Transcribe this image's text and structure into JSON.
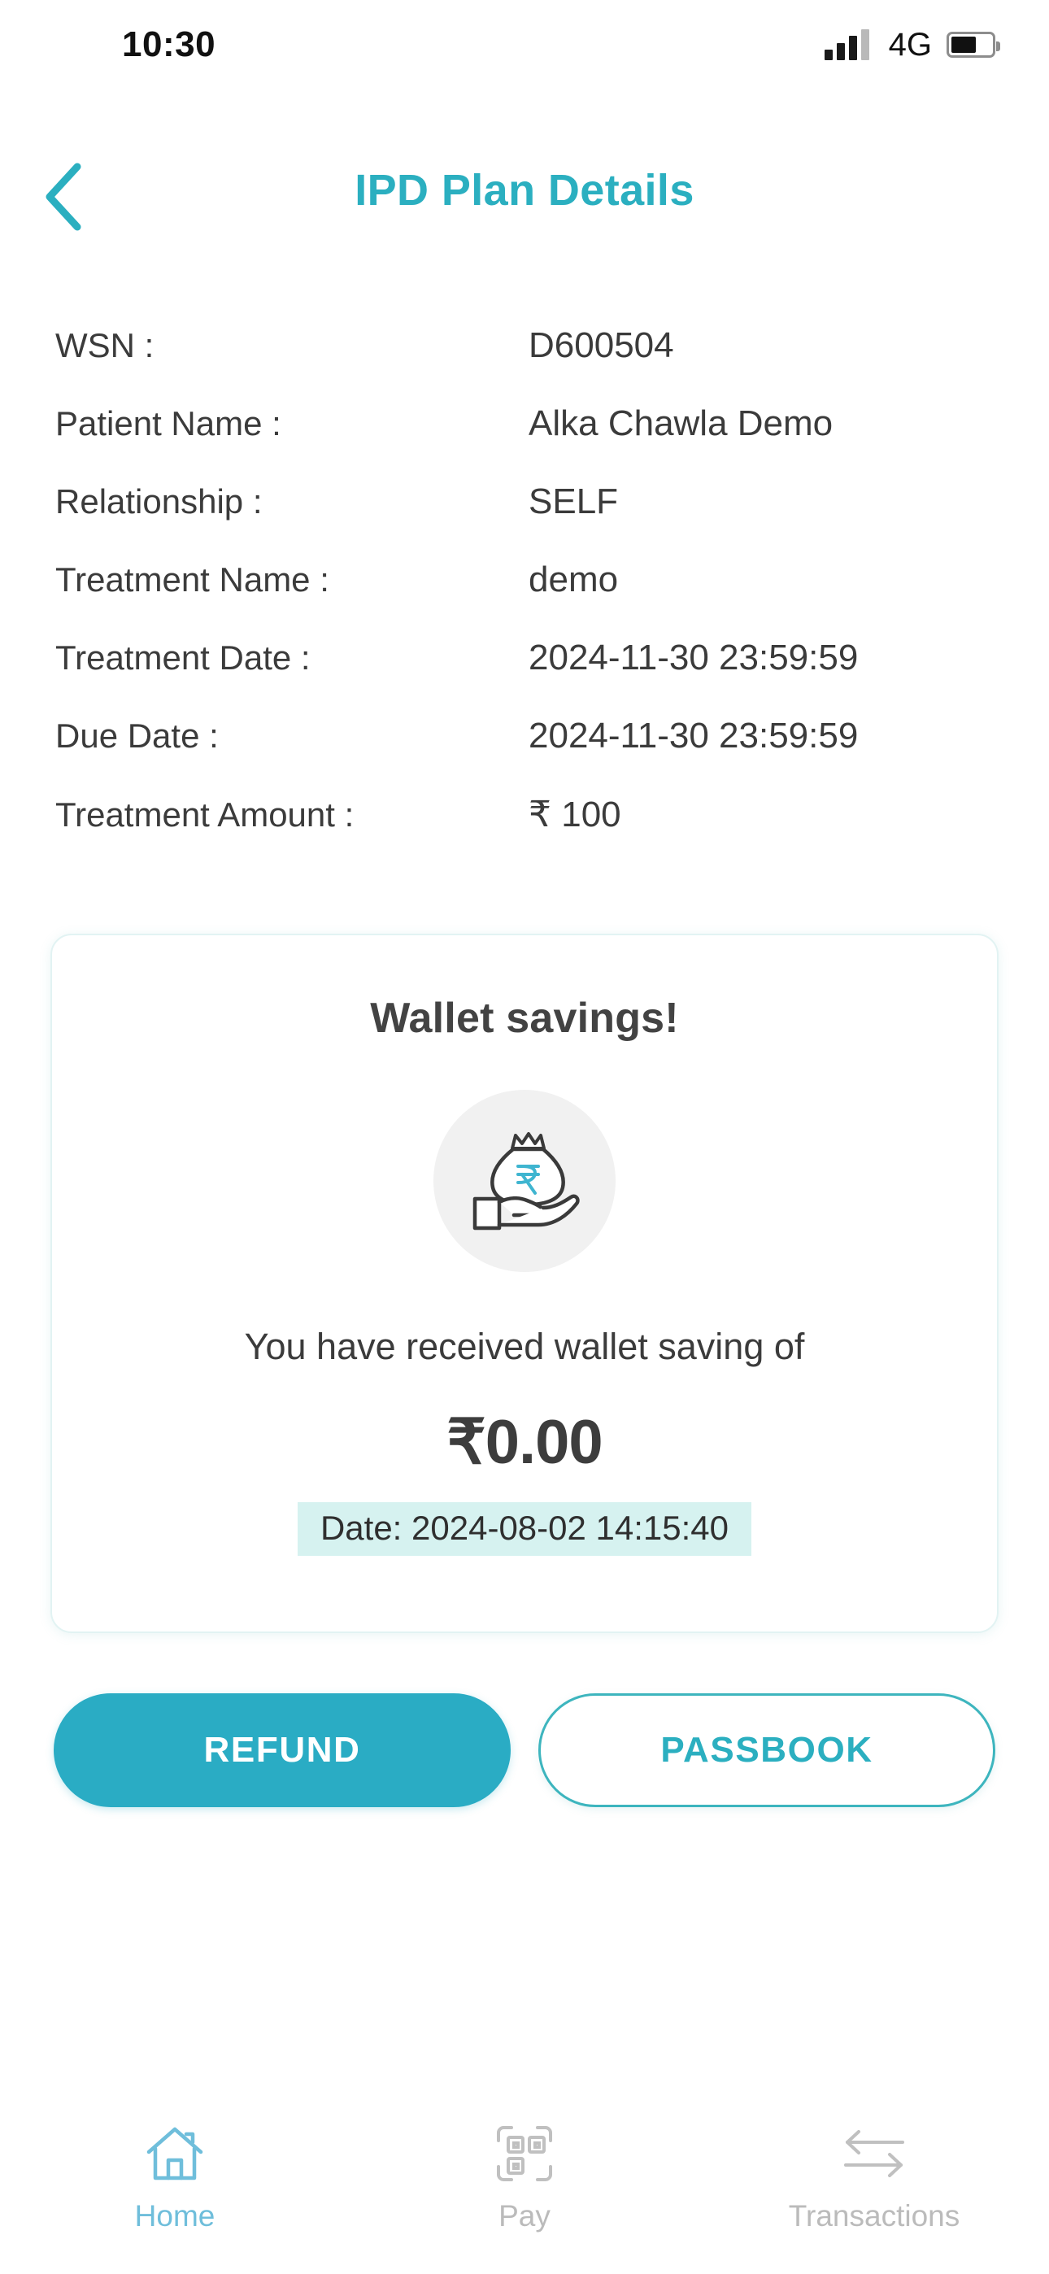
{
  "status_bar": {
    "time": "10:30",
    "network": "4G",
    "signal_icon": "signal-bars-icon",
    "battery_icon": "battery-icon",
    "battery_level_percent": 62
  },
  "header": {
    "back_icon": "chevron-left-icon",
    "title": "IPD Plan Details",
    "title_color": "#2BAFC0"
  },
  "details": {
    "rows": [
      {
        "label": "WSN :",
        "value": "D600504"
      },
      {
        "label": "Patient Name :",
        "value": "Alka Chawla Demo"
      },
      {
        "label": "Relationship :",
        "value": "SELF"
      },
      {
        "label": "Treatment Name :",
        "value": "demo"
      },
      {
        "label": "Treatment Date :",
        "value": "2024-11-30 23:59:59"
      },
      {
        "label": "Due Date :",
        "value": "2024-11-30 23:59:59"
      },
      {
        "label": "Treatment Amount :",
        "value": "₹ 100"
      }
    ]
  },
  "wallet_card": {
    "title": "Wallet savings!",
    "icon": "money-bag-in-hand-icon",
    "icon_currency_symbol": "₹",
    "message": "You have received wallet saving of",
    "amount": "₹0.00",
    "date_text": "Date: 2024-08-02 14:15:40",
    "date_highlight_color": "#D6F2F0"
  },
  "actions": {
    "refund_label": "REFUND",
    "passbook_label": "PASSBOOK",
    "primary_color": "#2AACC4",
    "outline_color": "#3DB5BE"
  },
  "bottom_nav": {
    "items": [
      {
        "label": "Home",
        "icon": "home-icon",
        "active": true,
        "color": "#6FBEDB"
      },
      {
        "label": "Pay",
        "icon": "qr-scan-icon",
        "active": false,
        "color": "#BBBBBB"
      },
      {
        "label": "Transactions",
        "icon": "transfer-arrows-icon",
        "active": false,
        "color": "#BBBBBB"
      }
    ]
  }
}
